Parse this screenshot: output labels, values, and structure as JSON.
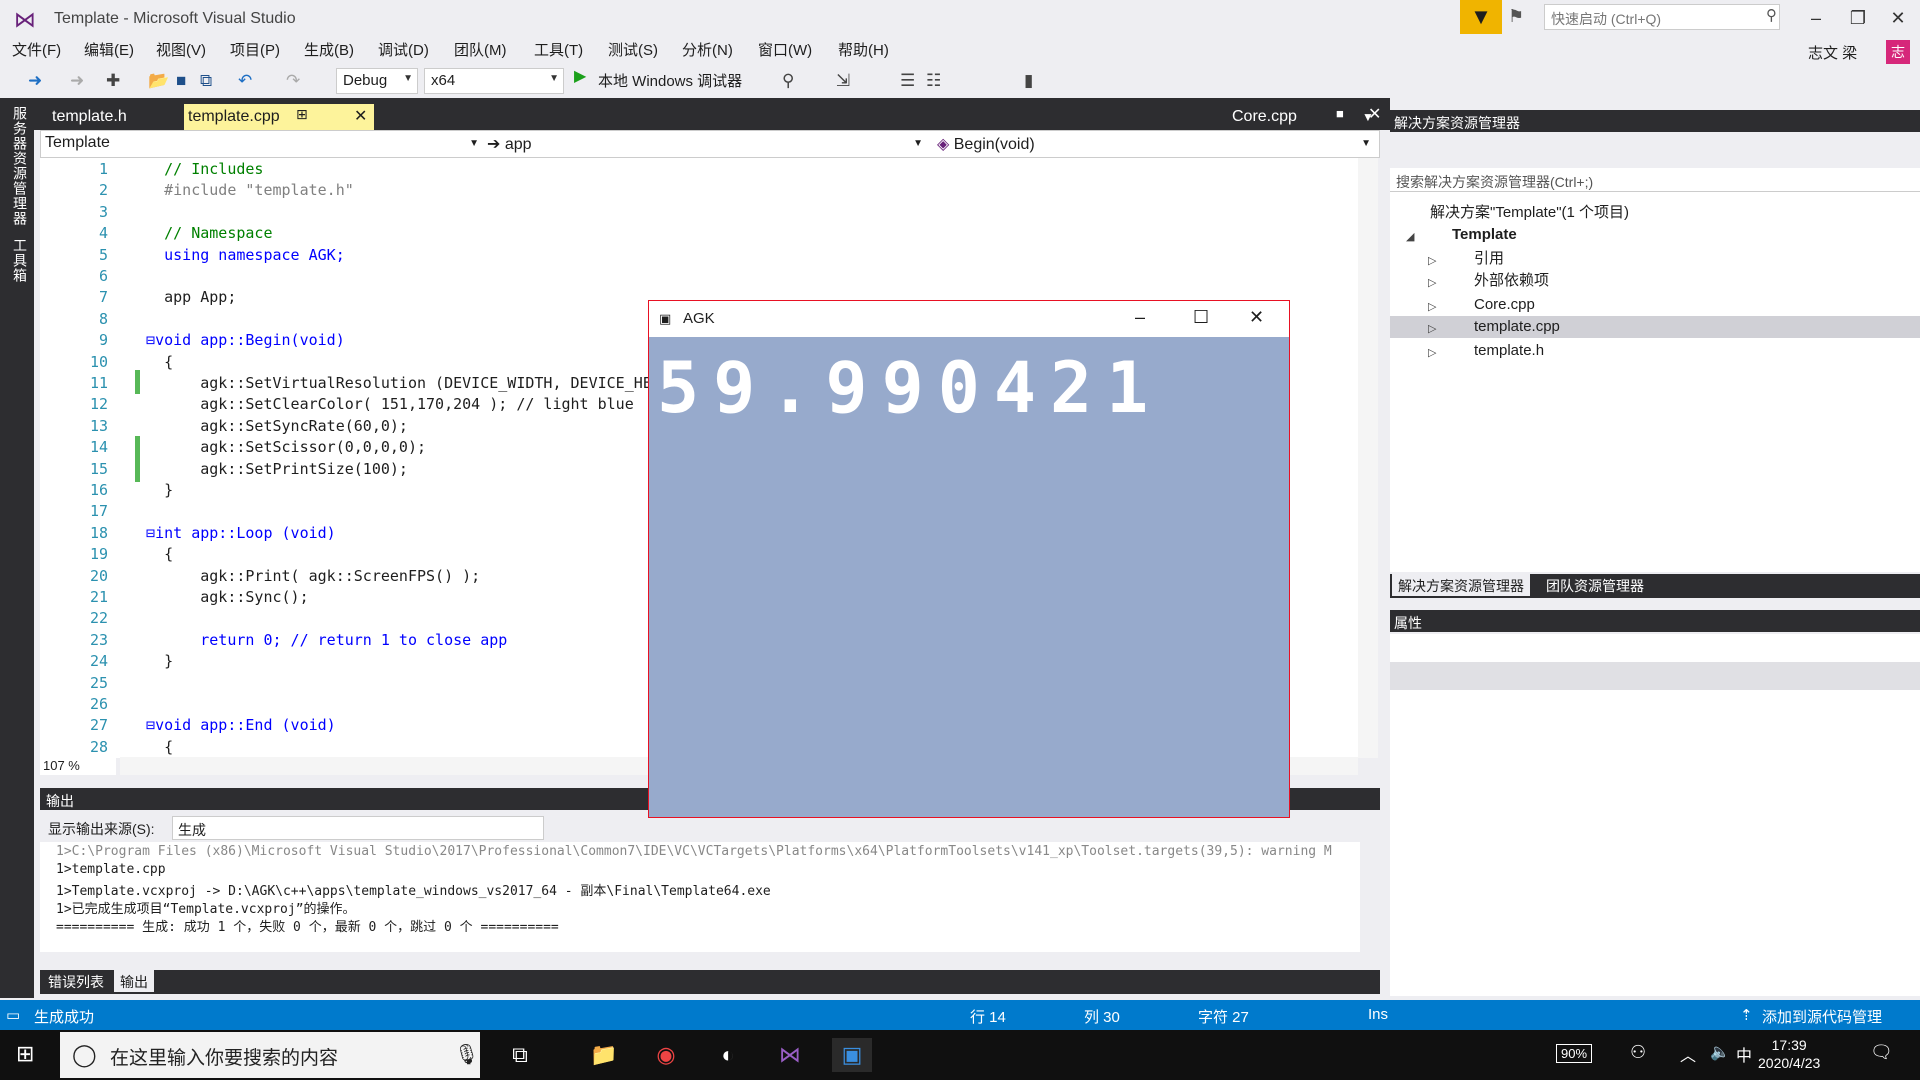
{
  "window": {
    "title": "Template - Microsoft Visual Studio",
    "quick_launch": "快速启动 (Ctrl+Q)",
    "user_name": "志文 梁",
    "avatar": "志"
  },
  "menu": [
    "文件(F)",
    "编辑(E)",
    "视图(V)",
    "项目(P)",
    "生成(B)",
    "调试(D)",
    "团队(M)",
    "工具(T)",
    "测试(S)",
    "分析(N)",
    "窗口(W)",
    "帮助(H)"
  ],
  "toolbar": {
    "config": "Debug",
    "platform": "x64",
    "run_label": "本地 Windows 调试器"
  },
  "left_strip": [
    "服务器资源管理器",
    "工具箱"
  ],
  "editor": {
    "tabs": [
      {
        "label": "template.h"
      },
      {
        "label": "template.cpp"
      },
      {
        "label": "Core.cpp"
      }
    ],
    "nav": {
      "scope": "Template",
      "class": "➔ app",
      "member": "Begin(void)"
    },
    "zoom": "107 %",
    "lines": [
      {
        "n": "1",
        "t": "    // Includes"
      },
      {
        "n": "2",
        "t": "    #include \"template.h\""
      },
      {
        "n": "3",
        "t": ""
      },
      {
        "n": "4",
        "t": "    // Namespace"
      },
      {
        "n": "5",
        "t": "    using namespace AGK;"
      },
      {
        "n": "6",
        "t": ""
      },
      {
        "n": "7",
        "t": "    app App;"
      },
      {
        "n": "8",
        "t": ""
      },
      {
        "n": "9",
        "t": "  ⊟void app::Begin(void)"
      },
      {
        "n": "10",
        "t": "    {"
      },
      {
        "n": "11",
        "t": "        agk::SetVirtualResolution (DEVICE_WIDTH, DEVICE_HEIGHT);"
      },
      {
        "n": "12",
        "t": "        agk::SetClearColor( 151,170,204 ); // light blue"
      },
      {
        "n": "13",
        "t": "        agk::SetSyncRate(60,0);"
      },
      {
        "n": "14",
        "t": "        agk::SetScissor(0,0,0,0);"
      },
      {
        "n": "15",
        "t": "        agk::SetPrintSize(100);"
      },
      {
        "n": "16",
        "t": "    }"
      },
      {
        "n": "17",
        "t": ""
      },
      {
        "n": "18",
        "t": "  ⊟int app::Loop (void)"
      },
      {
        "n": "19",
        "t": "    {"
      },
      {
        "n": "20",
        "t": "        agk::Print( agk::ScreenFPS() );"
      },
      {
        "n": "21",
        "t": "        agk::Sync();"
      },
      {
        "n": "22",
        "t": ""
      },
      {
        "n": "23",
        "t": "        return 0; // return 1 to close app"
      },
      {
        "n": "24",
        "t": "    }"
      },
      {
        "n": "25",
        "t": ""
      },
      {
        "n": "26",
        "t": ""
      },
      {
        "n": "27",
        "t": "  ⊟void app::End (void)"
      },
      {
        "n": "28",
        "t": "    {"
      }
    ]
  },
  "output": {
    "title": "输出",
    "source_label": "显示输出来源(S):",
    "source_value": "生成",
    "lines": [
      "1>C:\\Program Files (x86)\\Microsoft Visual Studio\\2017\\Professional\\Common7\\IDE\\VC\\VCTargets\\Platforms\\x64\\PlatformToolsets\\v141_xp\\Toolset.targets(39,5): warning M",
      "1>template.cpp",
      "1>Template.vcxproj -> D:\\AGK\\c++\\apps\\template_windows_vs2017_64 - 副本\\Final\\Template64.exe",
      "1>已完成生成项目“Template.vcxproj”的操作。",
      "========== 生成: 成功 1 个，失败 0 个，最新 0 个，跳过 0 个 =========="
    ],
    "tabs": [
      "错误列表",
      "输出"
    ]
  },
  "solution_explorer": {
    "title": "解决方案资源管理器",
    "search": "搜索解决方案资源管理器(Ctrl+;)",
    "items": [
      {
        "label": "解决方案\"Template\"(1 个项目)"
      },
      {
        "label": "Template"
      },
      {
        "label": "引用"
      },
      {
        "label": "外部依赖项"
      },
      {
        "label": "Core.cpp"
      },
      {
        "label": "template.cpp"
      },
      {
        "label": "template.h"
      }
    ],
    "tabs": [
      "解决方案资源管理器",
      "团队资源管理器"
    ]
  },
  "properties": {
    "title": "属性"
  },
  "agk": {
    "title": "AGK",
    "fps": "59.990421"
  },
  "status": {
    "state": "生成成功",
    "row": "行 14",
    "col": "列 30",
    "char": "字符 27",
    "ins": "Ins",
    "source_control": "添加到源代码管理"
  },
  "taskbar": {
    "search": "在这里输入你要搜索的内容",
    "battery": "90%",
    "ime": "中",
    "time": "17:39",
    "date": "2020/4/23"
  }
}
